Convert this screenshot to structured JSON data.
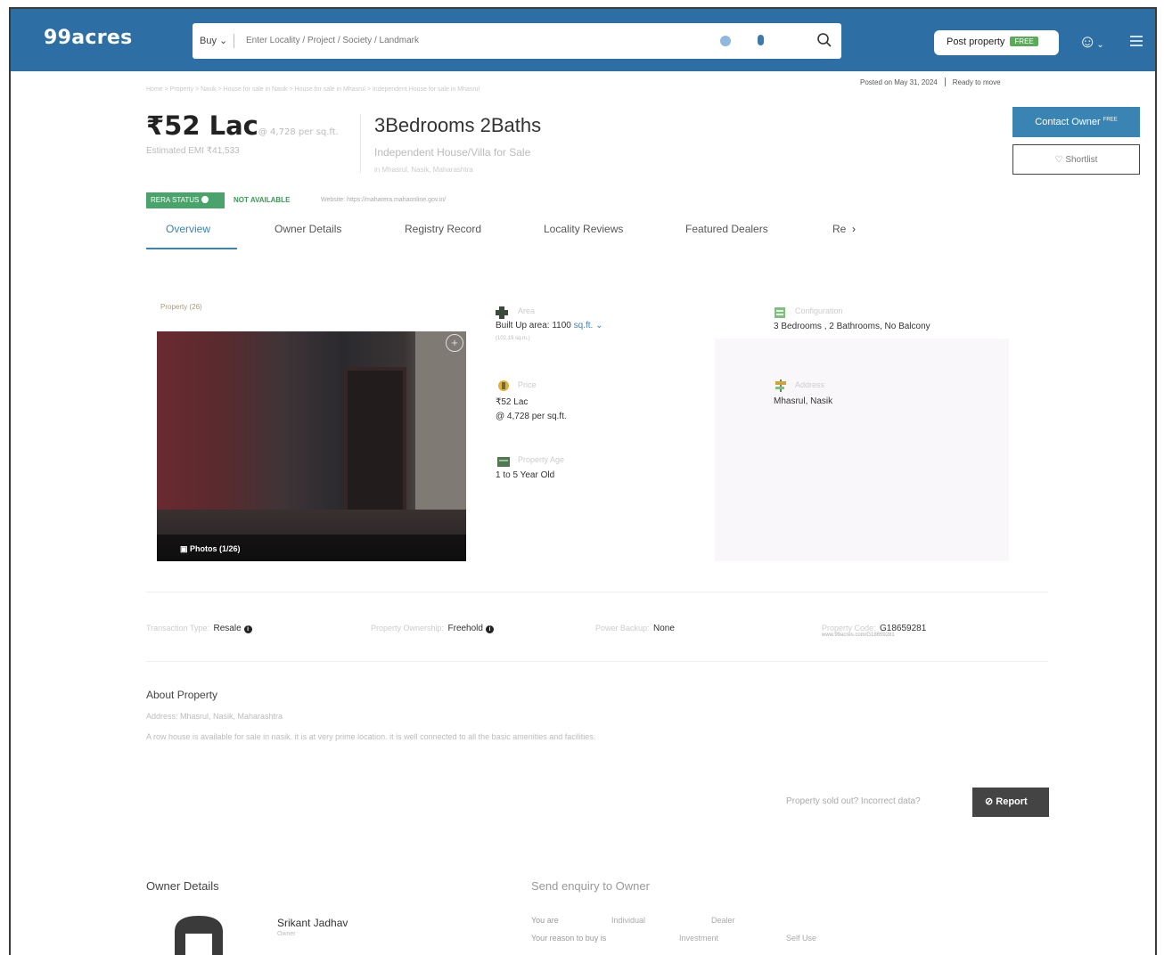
{
  "header": {
    "logo": "99acres",
    "buy_label": "Buy ⌄",
    "search_placeholder": "Enter Locality / Project / Society / Landmark",
    "post_property_label": "Post property",
    "post_property_badge": "FREE",
    "brand_color": "#2d6fa4"
  },
  "meta": {
    "breadcrumb": "Home > Property > Nasik > House for sale in Nasik > House for sale in Mhasrul > Independent House for sale in Mhasrul",
    "posted": "Posted on May 31, 2024",
    "status": "Ready to move"
  },
  "listing": {
    "price": "₹52 Lac",
    "price_per": "@ 4,728 per sq.ft.",
    "emi": "Estimated EMI ₹41,533",
    "title": "3Bedrooms 2Baths",
    "subtitle": "Independent House/Villa for Sale",
    "sublocation": "in Mhasrul, Nasik, Maharashtra",
    "contact_label": "Contact Owner",
    "contact_badge": "FREE",
    "shortlist_label": "Shortlist"
  },
  "rera": {
    "badge": "RERA STATUS",
    "status": "NOT AVAILABLE",
    "website": "Website: https://maharera.mahaonline.gov.in/"
  },
  "tabs": [
    "Overview",
    "Owner Details",
    "Registry Record",
    "Locality Reviews",
    "Featured Dealers",
    "Re"
  ],
  "photo": {
    "label": "Property (26)",
    "counter": "Photos (1/26)"
  },
  "specs": {
    "area_label": "Area",
    "area_value": "Built Up area: 1100",
    "area_unit": "sq.ft. ⌄",
    "area_sub": "(102.19 sq.m.)",
    "config_label": "Configuration",
    "config_value": "3 Bedrooms , 2 Bathrooms, No Balcony",
    "price_label": "Price",
    "price_value": "₹52 Lac",
    "price_per": "@ 4,728 per sq.ft.",
    "address_label": "Address",
    "address_value": "Mhasrul, Nasik",
    "age_label": "Property Age",
    "age_value": "1 to 5 Year Old"
  },
  "facts": {
    "transaction_label": "Transaction Type:",
    "transaction_value": "Resale",
    "ownership_label": "Property Ownership:",
    "ownership_value": "Freehold",
    "backup_label": "Power Backup:",
    "backup_value": "None",
    "code_label": "Property Code:",
    "code_value": "G18659281",
    "code_url": "www.99acres.com/G18659281"
  },
  "about": {
    "title": "About Property",
    "address": "Address: Mhasrul, Nasik, Maharashtra",
    "description": "A row house is available for sale in nasik. it is at very prime location. it is well connected to all the basic amenities and facilities."
  },
  "report": {
    "question": "Property sold out? Incorrect data?",
    "button": "Report"
  },
  "owner": {
    "title": "Owner Details",
    "name": "Srikant Jadhav",
    "role": "Owner"
  },
  "enquiry": {
    "title": "Send enquiry to Owner",
    "you_are": "You are",
    "you_are_opts": [
      "Individual",
      "Dealer"
    ],
    "reason": "Your reason to buy is",
    "reason_opts": [
      "Investment",
      "Self Use"
    ]
  }
}
